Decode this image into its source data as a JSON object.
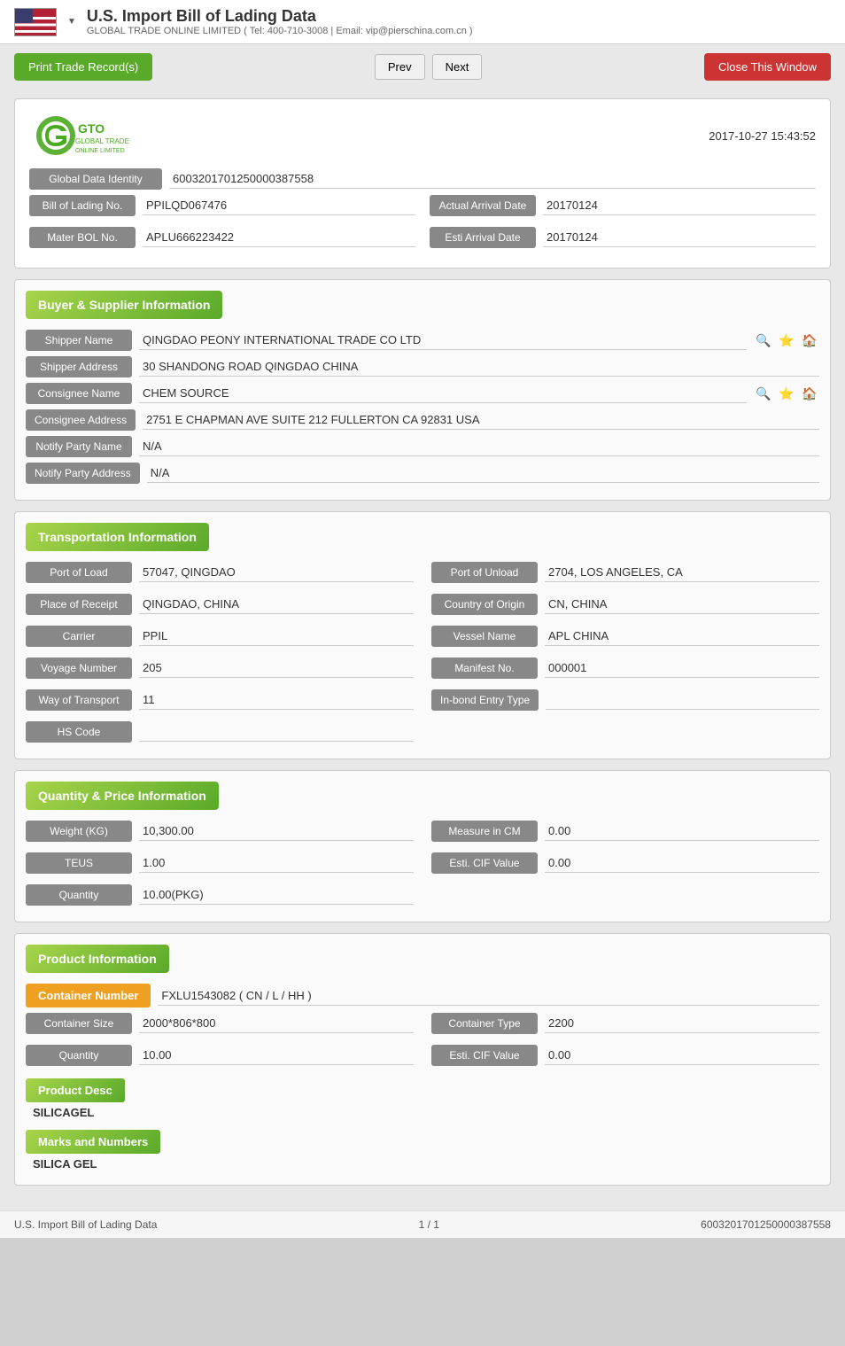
{
  "header": {
    "title": "U.S. Import Bill of Lading Data",
    "subtitle": "GLOBAL TRADE ONLINE LIMITED ( Tel: 400-710-3008 | Email: vip@pierschina.com.cn )",
    "dropdown_arrow": "▼",
    "timestamp": "2017-10-27 15:43:52"
  },
  "toolbar": {
    "print_label": "Print Trade Record(s)",
    "prev_label": "Prev",
    "next_label": "Next",
    "close_label": "Close This Window"
  },
  "identity": {
    "global_data_label": "Global Data Identity",
    "global_data_value": "600320170125000038755​8",
    "bol_label": "Bill of Lading No.",
    "bol_value": "PPILQD067476",
    "actual_arrival_label": "Actual Arrival Date",
    "actual_arrival_value": "20170124",
    "mater_bol_label": "Mater BOL No.",
    "mater_bol_value": "APLU666223422",
    "esti_arrival_label": "Esti Arrival Date",
    "esti_arrival_value": "20170124"
  },
  "buyer_supplier": {
    "section_title": "Buyer & Supplier Information",
    "shipper_name_label": "Shipper Name",
    "shipper_name_value": "QINGDAO PEONY INTERNATIONAL TRADE CO LTD",
    "shipper_address_label": "Shipper Address",
    "shipper_address_value": "30 SHANDONG ROAD QINGDAO CHINA",
    "consignee_name_label": "Consignee Name",
    "consignee_name_value": "CHEM SOURCE",
    "consignee_address_label": "Consignee Address",
    "consignee_address_value": "2751 E CHAPMAN AVE SUITE 212 FULLERTON CA 92831 USA",
    "notify_party_name_label": "Notify Party Name",
    "notify_party_name_value": "N/A",
    "notify_party_address_label": "Notify Party Address",
    "notify_party_address_value": "N/A"
  },
  "transportation": {
    "section_title": "Transportation Information",
    "port_of_load_label": "Port of Load",
    "port_of_load_value": "57047, QINGDAO",
    "port_of_unload_label": "Port of Unload",
    "port_of_unload_value": "2704, LOS ANGELES, CA",
    "place_of_receipt_label": "Place of Receipt",
    "place_of_receipt_value": "QINGDAO, CHINA",
    "country_of_origin_label": "Country of Origin",
    "country_of_origin_value": "CN, CHINA",
    "carrier_label": "Carrier",
    "carrier_value": "PPIL",
    "vessel_name_label": "Vessel Name",
    "vessel_name_value": "APL CHINA",
    "voyage_number_label": "Voyage Number",
    "voyage_number_value": "205",
    "manifest_no_label": "Manifest No.",
    "manifest_no_value": "000001",
    "way_of_transport_label": "Way of Transport",
    "way_of_transport_value": "11",
    "inbond_entry_label": "In-bond Entry Type",
    "inbond_entry_value": "",
    "hs_code_label": "HS Code",
    "hs_code_value": ""
  },
  "quantity_price": {
    "section_title": "Quantity & Price Information",
    "weight_kg_label": "Weight (KG)",
    "weight_kg_value": "10,300.00",
    "measure_cm_label": "Measure in CM",
    "measure_cm_value": "0.00",
    "teus_label": "TEUS",
    "teus_value": "1.00",
    "esti_cif_label": "Esti. CIF Value",
    "esti_cif_value": "0.00",
    "quantity_label": "Quantity",
    "quantity_value": "10.00(PKG)"
  },
  "product_info": {
    "section_title": "Product Information",
    "container_number_label": "Container Number",
    "container_number_value": "FXLU1543082 ( CN / L / HH )",
    "container_size_label": "Container Size",
    "container_size_value": "2000*806*800",
    "container_type_label": "Container Type",
    "container_type_value": "2200",
    "quantity_label": "Quantity",
    "quantity_value": "10.00",
    "esti_cif_label": "Esti. CIF Value",
    "esti_cif_value": "0.00",
    "product_desc_label": "Product Desc",
    "product_desc_value": "SILICAGEL",
    "marks_numbers_label": "Marks and Numbers",
    "marks_numbers_value": "SILICA GEL"
  },
  "footer": {
    "left": "U.S. Import Bill of Lading Data",
    "center": "1 / 1",
    "right": "600320170125000038755​8"
  },
  "icons": {
    "search": "🔍",
    "star": "⭐",
    "home": "🏠"
  }
}
